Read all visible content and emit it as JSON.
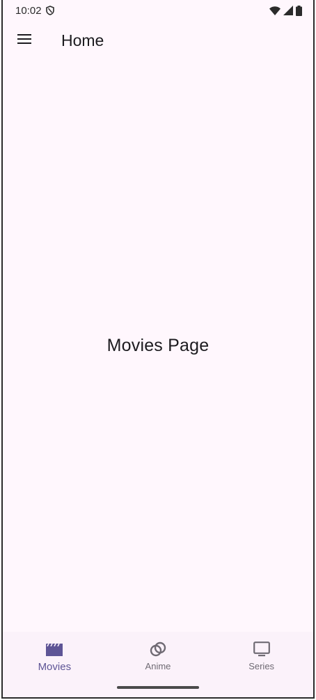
{
  "status_bar": {
    "time": "10:02",
    "icons": [
      "shield-icon",
      "wifi-icon",
      "signal-icon",
      "battery-icon"
    ]
  },
  "app_bar": {
    "menu_icon": "hamburger-menu-icon",
    "title": "Home"
  },
  "main": {
    "page_label": "Movies Page"
  },
  "bottom_nav": {
    "active_color": "#5e5596",
    "inactive_color": "#6f6a73",
    "items": [
      {
        "label": "Movies",
        "icon": "clapperboard-icon",
        "active": true
      },
      {
        "label": "Anime",
        "icon": "interlocked-rings-icon",
        "active": false
      },
      {
        "label": "Series",
        "icon": "tv-icon",
        "active": false
      }
    ]
  },
  "colors": {
    "background": "#fff7fd",
    "nav_background": "#fbf2fa"
  }
}
